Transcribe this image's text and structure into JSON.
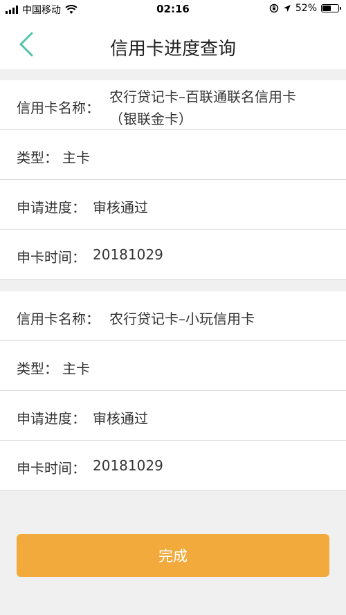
{
  "status": {
    "carrier": "中国移动",
    "time": "02:16",
    "battery_percent": 52,
    "battery_text": "52%",
    "icons": [
      "signal-icon",
      "wifi-icon",
      "orientation-lock-icon",
      "location-icon",
      "battery-icon"
    ]
  },
  "nav": {
    "back_icon": "chevron-left-icon",
    "title": "信用卡进度查询",
    "accent_color": "#4ec3a8"
  },
  "cards": [
    {
      "name_label": "信用卡名称：",
      "name_line1": "农行贷记卡–百联通联名信用卡",
      "name_line2": "（银联金卡）",
      "type_label": "类型：",
      "type_value": "主卡",
      "progress_label": "申请进度：",
      "progress_value": "审核通过",
      "date_label": "申卡时间：",
      "date_value": "20181029"
    },
    {
      "name_label": "信用卡名称：",
      "name_value": "农行贷记卡–小玩信用卡",
      "type_label": "类型：",
      "type_value": "主卡",
      "progress_label": "申请进度：",
      "progress_value": "审核通过",
      "date_label": "申卡时间：",
      "date_value": "20181029"
    }
  ],
  "button": {
    "label": "完成",
    "color": "#f2aa3c"
  }
}
